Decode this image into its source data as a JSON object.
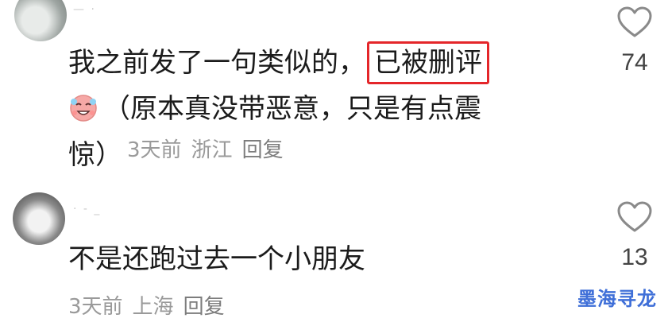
{
  "comments": [
    {
      "username": "— ·",
      "text_line1": "我之前发了一句类似的，",
      "highlight": "已被删评",
      "emoji": "crying-laughing-emoji",
      "text_line2": "（原本真没带恶意，只是有点震",
      "text_line3": "惊）",
      "time": "3天前",
      "location": "浙江",
      "reply_label": "回复",
      "likes": "74"
    },
    {
      "username": "· - _",
      "text": "不是还跑过去一个小朋友",
      "time": "3天前",
      "location": "上海",
      "reply_label": "回复",
      "likes": "13"
    }
  ],
  "watermark": "墨海寻龙",
  "colors": {
    "highlight_border": "#e4262a",
    "meta_text": "#9a9a9a",
    "watermark": "#3f6fd8"
  }
}
